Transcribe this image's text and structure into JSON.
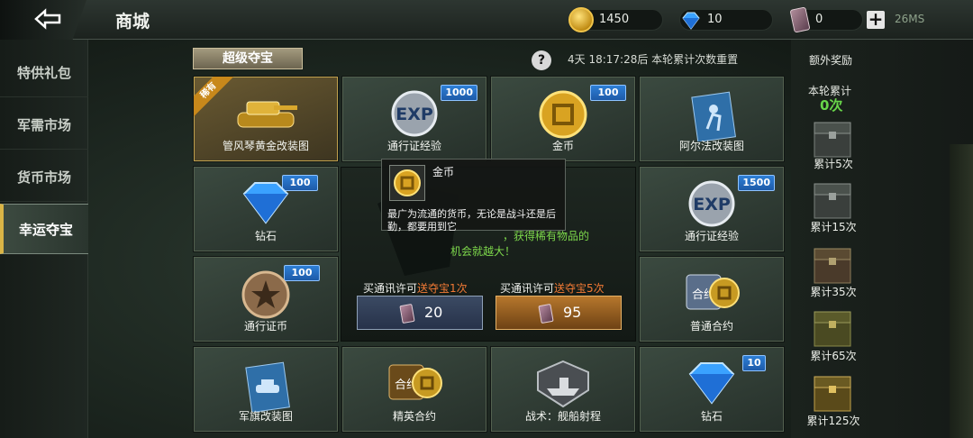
{
  "header": {
    "title": "商城"
  },
  "resources": {
    "coins": "1450",
    "gems": "10",
    "tickets": "0",
    "ping": "26MS"
  },
  "sidebar": {
    "items": [
      {
        "label": "特供礼包",
        "active": false
      },
      {
        "label": "军需市场",
        "active": false
      },
      {
        "label": "货币市场",
        "active": false
      },
      {
        "label": "幸运夺宝",
        "active": true
      }
    ]
  },
  "section": {
    "title": "超级夺宝",
    "timer": "4天 18:17:28后 本轮累计次数重置",
    "help": "?"
  },
  "grid": {
    "items": [
      {
        "label": "管风琴黄金改装图",
        "badge": "",
        "ribbon": "稀有",
        "icon": "gold-tank-icon"
      },
      {
        "label": "通行证经验",
        "badge": "1000",
        "icon": "exp-icon"
      },
      {
        "label": "金币",
        "badge": "100",
        "icon": "gold-coin-icon"
      },
      {
        "label": "阿尔法改装图",
        "badge": "",
        "icon": "blueprint-soldier-icon"
      },
      {
        "label": "钻石",
        "badge": "100",
        "icon": "diamond-icon"
      },
      {
        "label": "通行证经验",
        "badge": "1500",
        "icon": "exp-icon"
      },
      {
        "label": "通行证币",
        "badge": "100",
        "icon": "pass-coin-icon"
      },
      {
        "label": "普通合约",
        "badge": "",
        "icon": "contract-icon"
      },
      {
        "label": "军旗改装图",
        "badge": "",
        "icon": "blueprint-tank-icon"
      },
      {
        "label": "精英合约",
        "badge": "",
        "icon": "elite-contract-icon"
      },
      {
        "label": "战术：舰船射程",
        "badge": "",
        "icon": "tactic-ship-icon"
      },
      {
        "label": "钻石",
        "badge": "10",
        "icon": "diamond-icon"
      }
    ]
  },
  "center": {
    "partial_text": "，获得稀有物品的",
    "partial_text2": "机会就越大！",
    "buy1": {
      "label_pre": "买通讯许可",
      "label_hl": "送夺宝1次",
      "cost": "20"
    },
    "buy5": {
      "label_pre": "买通讯许可",
      "label_hl": "送夺宝5次",
      "cost": "95"
    }
  },
  "tooltip": {
    "title": "金币",
    "desc": "最广为流通的货币，无论是战斗还是后勤，都要用到它"
  },
  "rewards": {
    "title": "额外奖励",
    "round_label": "本轮累计",
    "round_count": "0次",
    "tiers": [
      "累计5次",
      "累计15次",
      "累计35次",
      "累计65次",
      "累计125次"
    ]
  },
  "colors": {
    "accent_gold": "#d9b446",
    "highlight_green": "#68d64a",
    "badge_blue": "#2e7fd6",
    "orange_text": "#f27a35"
  }
}
